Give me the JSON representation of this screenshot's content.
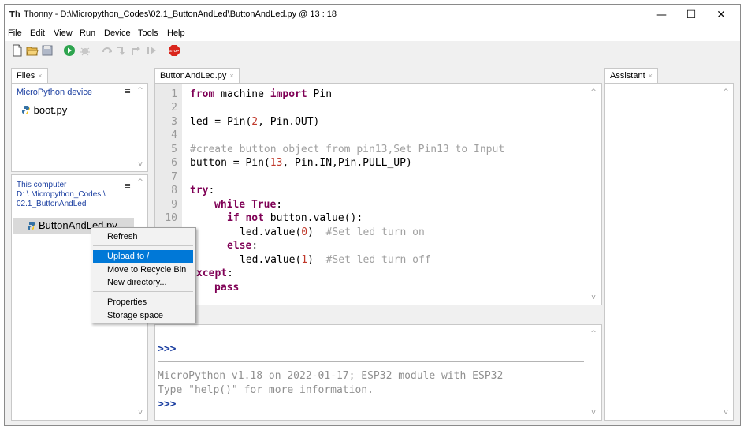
{
  "window": {
    "title": "Thonny  -  D:\\Micropython_Codes\\02.1_ButtonAndLed\\ButtonAndLed.py  @  13 : 18",
    "app_icon": "Th",
    "minimize": "—",
    "maximize": "☐",
    "close": "✕"
  },
  "menu": [
    "File",
    "Edit",
    "View",
    "Run",
    "Device",
    "Tools",
    "Help"
  ],
  "toolbar": {
    "icons": [
      "new-file-icon",
      "open-file-icon",
      "save-icon",
      "run-icon",
      "debug-icon",
      "step-over-icon",
      "step-into-icon",
      "step-out-icon",
      "resume-icon",
      "stop-icon"
    ],
    "stop_label": "STOP"
  },
  "files_panel": {
    "tab_label": "Files",
    "tab_close": "×",
    "device": {
      "header": "MicroPython device",
      "menu_glyph": "≡",
      "files": [
        "boot.py"
      ]
    },
    "computer": {
      "header": "This computer",
      "path_line1": "D: \\ Micropython_Codes \\",
      "path_line2": "02.1_ButtonAndLed",
      "menu_glyph": "≡",
      "files": [
        "ButtonAndLed.py"
      ]
    }
  },
  "context_menu": {
    "items": [
      "Refresh",
      "Upload to /",
      "Move to Recycle Bin",
      "New directory...",
      "Properties",
      "Storage space"
    ],
    "highlighted": "Upload to /"
  },
  "editor": {
    "tab_label": "ButtonAndLed.py",
    "tab_close": "×",
    "line_numbers": [
      "1",
      "2",
      "3",
      "4",
      "5",
      "6",
      "7",
      "8",
      "9",
      "10"
    ],
    "code": {
      "l1_kw1": "from",
      "l1_mid": " machine ",
      "l1_kw2": "import",
      "l1_end": " Pin",
      "l3_a": "led = Pin(",
      "l3_num": "2",
      "l3_b": ", Pin.OUT)",
      "l5_comment": "#create button object from pin13,Set Pin13 to Input",
      "l6_a": "button = Pin(",
      "l6_num": "13",
      "l6_b": ", Pin.IN,Pin.PULL_UP)",
      "l8_kw": "try",
      "l8_colon": ":",
      "l9_kw1": "while",
      "l9_kw2": "True",
      "l9_colon": ":",
      "l10_kw1": "if",
      "l10_kw2": "not",
      "l10_rest": " button.value():",
      "l11_a": "led.value(",
      "l11_num": "0",
      "l11_b": ")  ",
      "l11_comment": "#Set led turn on",
      "l12_kw": "else",
      "l12_colon": ":",
      "l13_a": "led.value(",
      "l13_num": "1",
      "l13_b": ")  ",
      "l13_comment": "#Set led turn off",
      "l14_kw": "xcept",
      "l14_colon": ":",
      "l15_kw": "pass"
    }
  },
  "shell": {
    "prompt1": ">>>",
    "banner1": "MicroPython v1.18 on 2022-01-17; ESP32 module with ESP32",
    "banner2": "Type \"help()\" for more information.",
    "prompt2": ">>>"
  },
  "assistant": {
    "tab_label": "Assistant",
    "tab_close": "×"
  },
  "scroll": {
    "up": "^",
    "down": "v"
  }
}
